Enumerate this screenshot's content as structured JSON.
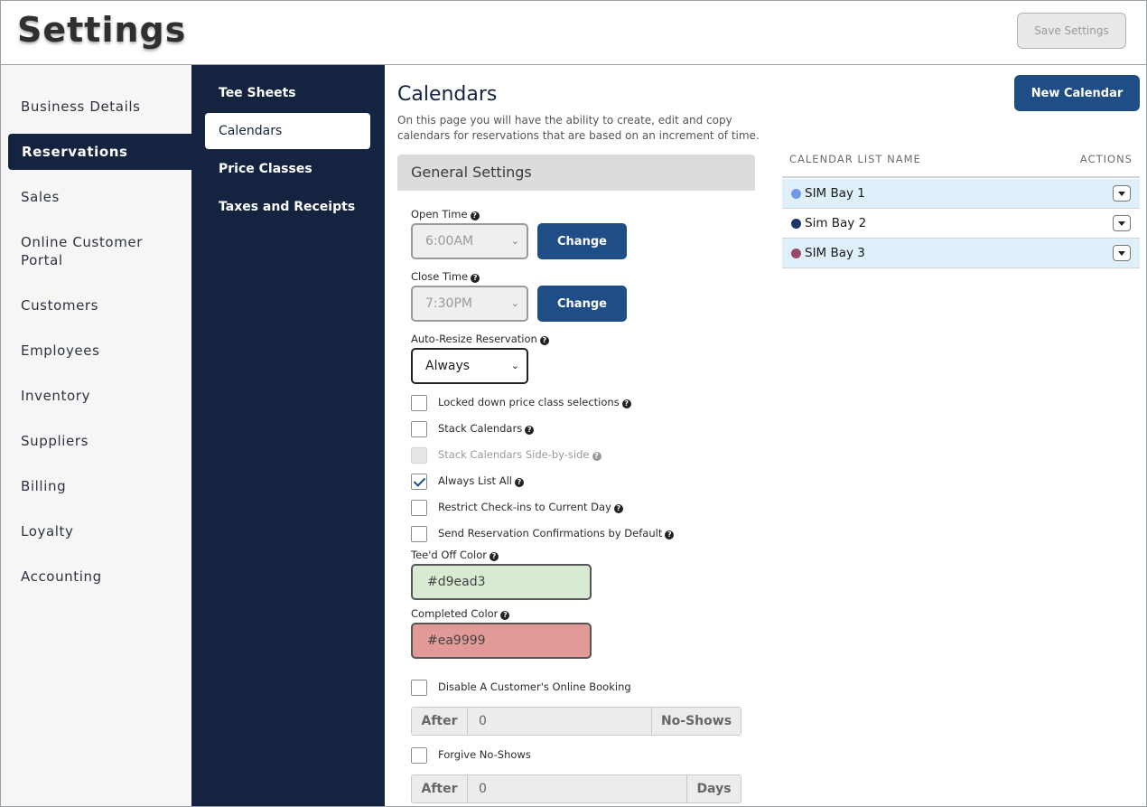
{
  "header": {
    "title": "Settings",
    "save_label": "Save Settings"
  },
  "sidebar": {
    "items": [
      {
        "label": "Business Details"
      },
      {
        "label": "Reservations",
        "active": true
      },
      {
        "label": "Sales"
      },
      {
        "label": "Online Customer Portal"
      },
      {
        "label": "Customers"
      },
      {
        "label": "Employees"
      },
      {
        "label": "Inventory"
      },
      {
        "label": "Suppliers"
      },
      {
        "label": "Billing"
      },
      {
        "label": "Loyalty"
      },
      {
        "label": "Accounting"
      }
    ]
  },
  "subnav": {
    "items": [
      {
        "label": "Tee Sheets"
      },
      {
        "label": "Calendars",
        "active": true
      },
      {
        "label": "Price Classes"
      },
      {
        "label": "Taxes and Receipts"
      }
    ]
  },
  "main": {
    "title": "Calendars",
    "description": "On this page you will have the ability to create, edit and copy calendars for reservations that are based on an increment of time.",
    "new_calendar_label": "New Calendar",
    "general_settings": {
      "header": "General Settings",
      "open_time": {
        "label": "Open Time",
        "value": "6:00AM",
        "change_label": "Change"
      },
      "close_time": {
        "label": "Close Time",
        "value": "7:30PM",
        "change_label": "Change"
      },
      "auto_resize": {
        "label": "Auto-Resize Reservation",
        "value": "Always"
      },
      "checkboxes": [
        {
          "label": "Locked down price class selections",
          "checked": false,
          "disabled": false
        },
        {
          "label": "Stack Calendars",
          "checked": false,
          "disabled": false
        },
        {
          "label": "Stack Calendars Side-by-side",
          "checked": false,
          "disabled": true
        },
        {
          "label": "Always List All",
          "checked": true,
          "disabled": false
        },
        {
          "label": "Restrict Check-ins to Current Day",
          "checked": false,
          "disabled": false
        },
        {
          "label": "Send Reservation Confirmations by Default",
          "checked": false,
          "disabled": false
        }
      ],
      "teed_off_color": {
        "label": "Tee'd Off Color",
        "value": "#d9ead3"
      },
      "completed_color": {
        "label": "Completed Color",
        "value": "#ea9999"
      },
      "disable_booking": {
        "label": "Disable A Customer's Online Booking",
        "checked": false
      },
      "no_show_group": {
        "prefix": "After",
        "value": "0",
        "suffix": "No-Shows"
      },
      "forgive": {
        "label": "Forgive No-Shows",
        "checked": false
      },
      "forgive_group": {
        "prefix": "After",
        "value": "0",
        "suffix": "Days"
      }
    },
    "calendar_list": {
      "header_name": "CALENDAR LIST NAME",
      "header_actions": "ACTIONS",
      "rows": [
        {
          "name": "SIM Bay 1",
          "color": "#6f9be6"
        },
        {
          "name": "Sim Bay 2",
          "color": "#1f3566"
        },
        {
          "name": "SIM Bay 3",
          "color": "#9a4a68"
        }
      ]
    }
  },
  "colors": {
    "navy": "#14233f",
    "primary_button": "#1f4d86",
    "alt_row": "#dff0fb"
  },
  "icons": {
    "help": "question-circle-icon",
    "select": "chevron-down-icon",
    "row_action": "caret-down-icon"
  }
}
